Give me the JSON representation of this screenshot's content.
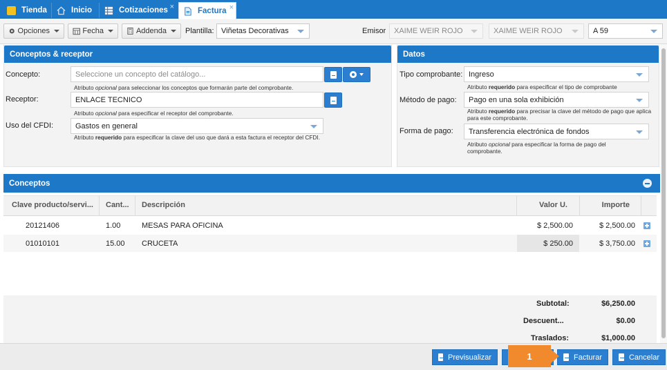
{
  "tabs": [
    {
      "label": "Tienda",
      "icon": "folder-icon",
      "closable": false
    },
    {
      "label": "Inicio",
      "icon": "home-icon",
      "closable": false
    },
    {
      "label": "Cotizaciones",
      "icon": "grid-icon",
      "closable": true
    },
    {
      "label": "Factura",
      "icon": "document-icon",
      "closable": true,
      "active": true
    }
  ],
  "close_glyph": "×",
  "toolbar": {
    "options_label": "Opciones",
    "date_label": "Fecha",
    "addenda_label": "Addenda",
    "template_label": "Plantilla:",
    "template_value": "Viñetas Decorativas",
    "emisor_label": "Emisor",
    "emisor_value_1": "XAIME WEIR ROJO",
    "emisor_value_2": "XAIME WEIR ROJO",
    "serie_value": "A 59"
  },
  "conceptos_receptor": {
    "title": "Conceptos & receptor",
    "concepto_label": "Concepto:",
    "concepto_placeholder": "Seleccione un concepto del catálogo...",
    "concepto_hint_pre": "Atributo ",
    "concepto_hint_em": "opcional",
    "concepto_hint_post": " para seleccionar los conceptos que formarán parte del comprobante.",
    "receptor_label": "Receptor:",
    "receptor_value": "ENLACE TECNICO",
    "receptor_hint_pre": "Atributo ",
    "receptor_hint_em": "opcional",
    "receptor_hint_post": " para especificar el receptor del comprobante.",
    "uso_label": "Uso del CFDI:",
    "uso_value": "Gastos en general",
    "uso_hint_pre": "Atributo ",
    "uso_hint_strong": "requerido",
    "uso_hint_post": " para especificar la clave del uso que dará a esta factura el receptor del CFDI."
  },
  "datos": {
    "title": "Datos",
    "tipo_label": "Tipo comprobante:",
    "tipo_value": "Ingreso",
    "tipo_hint_pre": "Atributo ",
    "tipo_hint_strong": "requerido",
    "tipo_hint_post": " para especificar el tipo de comprobante",
    "metodo_label": "Método de pago:",
    "metodo_value": "Pago en una sola exhibición",
    "metodo_hint_pre": "Atributo ",
    "metodo_hint_strong": "requerido",
    "metodo_hint_post": " para precisar la clave del método de pago que aplica para este comprobante.",
    "forma_label": "Forma de pago:",
    "forma_value": "Transferencia electrónica de fondos",
    "forma_hint_pre": "Atributo ",
    "forma_hint_em": "opcional",
    "forma_hint_post": " para especificar la forma de pago del comprobante."
  },
  "conceptos": {
    "title": "Conceptos",
    "columns": {
      "clave": "Clave producto/servi...",
      "cantidad": "Cant...",
      "descripcion": "Descripción",
      "valor": "Valor U.",
      "importe": "Importe"
    },
    "rows": [
      {
        "clave": "20121406",
        "cantidad": "1.00",
        "descripcion": "MESAS PARA OFICINA",
        "valor": "$ 2,500.00",
        "importe": "$ 2,500.00"
      },
      {
        "clave": "01010101",
        "cantidad": "15.00",
        "descripcion": "CRUCETA",
        "valor": "$ 250.00",
        "importe": "$ 3,750.00"
      }
    ],
    "totals": {
      "subtotal_label": "Subtotal:",
      "subtotal_value": "$6,250.00",
      "descuento_label": "Descuent...",
      "descuento_value": "$0.00",
      "traslados_label": "Traslados:",
      "traslados_value": "$1,000.00"
    }
  },
  "buttons": {
    "preview": "Previsualizar",
    "facturar": "Facturar",
    "cancelar": "Cancelar"
  },
  "step_badge": "1",
  "colors": {
    "primary": "#1e78c8",
    "button": "#2c7fd0",
    "badge": "#f08a2c"
  }
}
